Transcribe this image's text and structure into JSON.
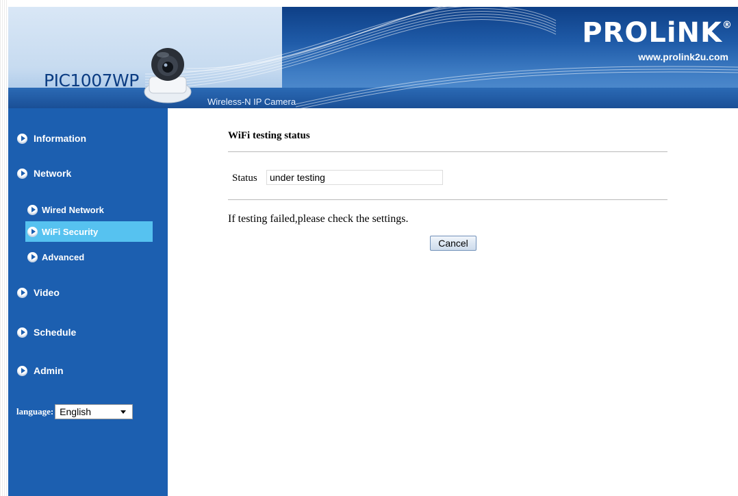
{
  "header": {
    "model": "PIC1007WP",
    "tagline": "Wireless-N IP Camera",
    "brand": "PROLiNK",
    "brand_mark": "®",
    "url": "www.prolink2u.com"
  },
  "sidebar": {
    "items": [
      {
        "label": "Information",
        "icon": "arrow-bullet-icon"
      },
      {
        "label": "Network",
        "icon": "arrow-bullet-icon"
      },
      {
        "label": "Wired Network",
        "icon": "arrow-bullet-icon"
      },
      {
        "label": "WiFi Security",
        "icon": "arrow-bullet-icon",
        "active": true
      },
      {
        "label": "Advanced",
        "icon": "arrow-bullet-icon"
      },
      {
        "label": "Video",
        "icon": "arrow-bullet-icon"
      },
      {
        "label": "Schedule",
        "icon": "arrow-bullet-icon"
      },
      {
        "label": "Admin",
        "icon": "arrow-bullet-icon"
      }
    ],
    "language": {
      "label": "language:",
      "selected": "English"
    }
  },
  "main": {
    "title": "WiFi testing status",
    "status_label": "Status",
    "status_value": "under testing",
    "message": "If testing failed,please check the settings.",
    "cancel_label": "Cancel"
  },
  "colors": {
    "sidebar_bg": "#1c5fb0",
    "sidebar_active": "#56c2f0",
    "header_dark": "#0e3f86"
  }
}
